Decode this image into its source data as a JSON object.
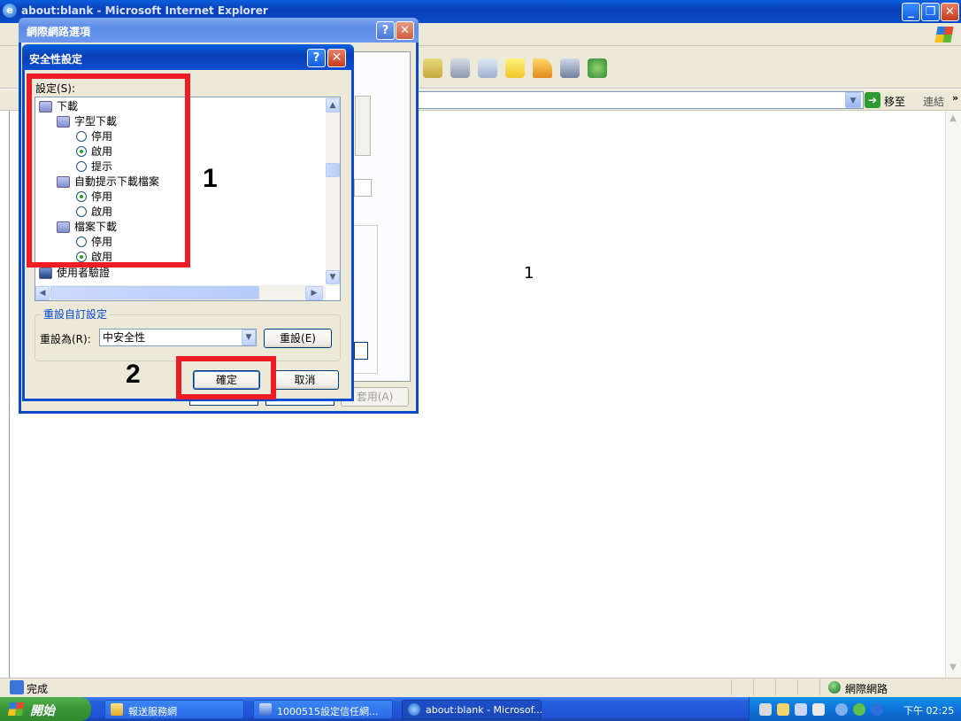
{
  "ie_window": {
    "title": "about:blank - Microsoft Internet Explorer",
    "go_label": "移至",
    "links_label": "連結",
    "links_chevron": "»",
    "status_text": "完成",
    "status_zone": "網際網路",
    "page_number": "1"
  },
  "caption_buttons": {
    "minimize": "_",
    "restore": "❐",
    "close": "✕",
    "help": "?"
  },
  "options_dialog": {
    "title": "網際網路選項",
    "apply_button": "套用(A)"
  },
  "security_dialog": {
    "title": "安全性設定",
    "settings_label": "設定(S):",
    "tree": [
      {
        "type": "node",
        "label": "下載",
        "level": 0
      },
      {
        "type": "node",
        "label": "字型下載",
        "level": 1
      },
      {
        "type": "radio",
        "label": "停用",
        "level": 2,
        "checked": false
      },
      {
        "type": "radio",
        "label": "啟用",
        "level": 2,
        "checked": true
      },
      {
        "type": "radio",
        "label": "提示",
        "level": 2,
        "checked": false
      },
      {
        "type": "node",
        "label": "自動提示下載檔案",
        "level": 1
      },
      {
        "type": "radio",
        "label": "停用",
        "level": 2,
        "checked": true
      },
      {
        "type": "radio",
        "label": "啟用",
        "level": 2,
        "checked": false
      },
      {
        "type": "node",
        "label": "檔案下載",
        "level": 1
      },
      {
        "type": "radio",
        "label": "停用",
        "level": 2,
        "checked": false
      },
      {
        "type": "radio",
        "label": "啟用",
        "level": 2,
        "checked": true
      },
      {
        "type": "node",
        "label": "使用者驗證",
        "level": 0
      }
    ],
    "reset_group_label": "重設自訂設定",
    "reset_to_label": "重設為(R):",
    "reset_level_value": "中安全性",
    "reset_button": "重設(E)",
    "ok_button": "確定",
    "cancel_button": "取消"
  },
  "annotations": {
    "step1": "1",
    "step2": "2"
  },
  "taskbar": {
    "start_label": "開始",
    "tasks": [
      {
        "label": "報送服務網",
        "active": false
      },
      {
        "label": "1000515設定信任網...",
        "active": false
      },
      {
        "label": "about:blank - Microsof...",
        "active": true
      }
    ],
    "clock": "下午 02:25"
  },
  "colors": {
    "xp_blue": "#0a49c8",
    "annotation_red": "#ee1c25",
    "radio_checked": "#21a121",
    "start_green": "#3c9a3a"
  }
}
